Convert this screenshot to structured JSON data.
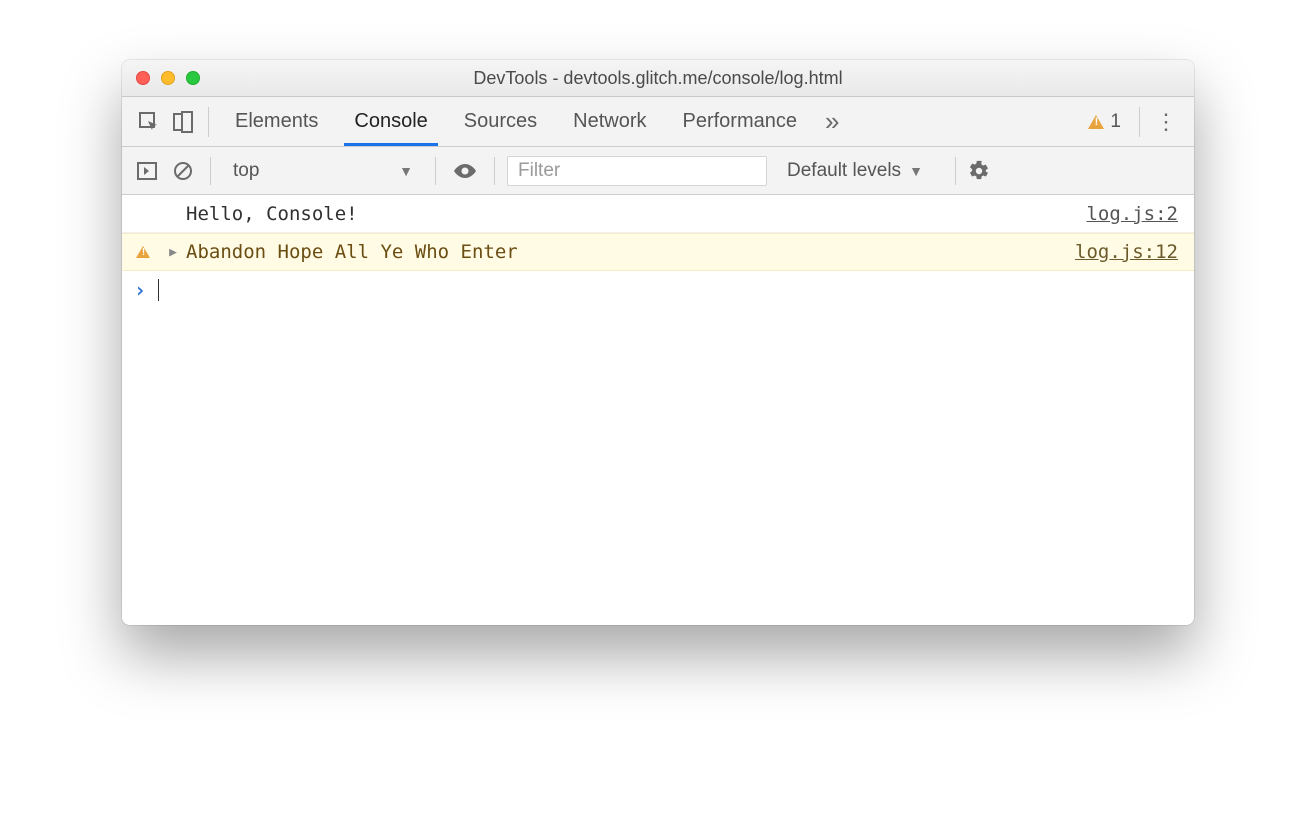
{
  "window": {
    "title": "DevTools - devtools.glitch.me/console/log.html"
  },
  "tabs": {
    "items": [
      "Elements",
      "Console",
      "Sources",
      "Network",
      "Performance"
    ],
    "active_index": 1,
    "overflow_glyph": "»"
  },
  "warnings": {
    "count": "1"
  },
  "toolbar": {
    "context": "top",
    "filter_placeholder": "Filter",
    "levels_label": "Default levels"
  },
  "console": {
    "rows": [
      {
        "type": "log",
        "message": "Hello, Console!",
        "source": "log.js:2"
      },
      {
        "type": "warn",
        "message": "Abandon Hope All Ye Who Enter",
        "source": "log.js:12"
      }
    ]
  }
}
